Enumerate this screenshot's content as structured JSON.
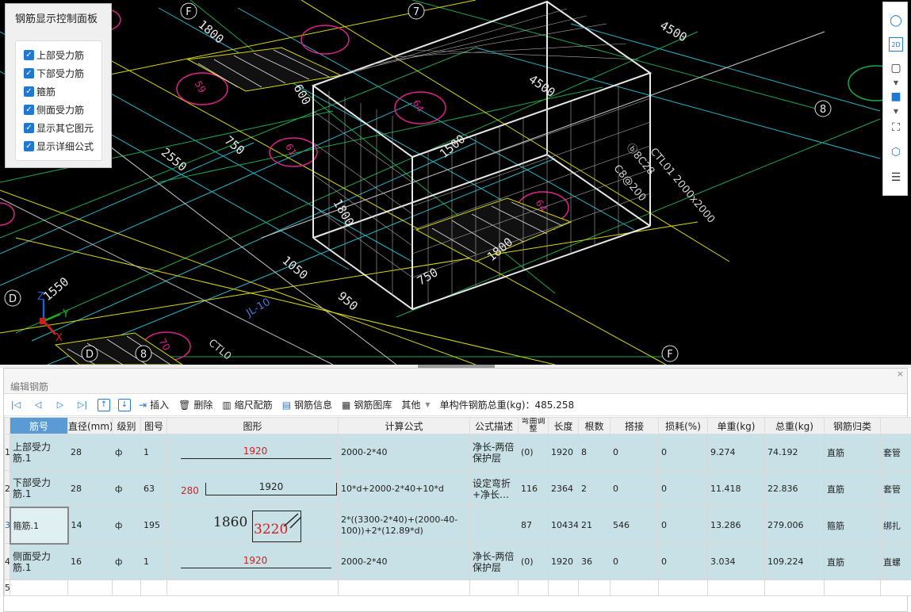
{
  "viewport": {
    "grid_labels": [
      "F",
      "7",
      "8",
      "D",
      "D",
      "8",
      "F"
    ],
    "dimensions": [
      "1800",
      "4500",
      "4500",
      "2550",
      "750",
      "1500",
      "1800",
      "1550",
      "1050",
      "950",
      "750",
      "1800",
      "750",
      "600"
    ],
    "circle_labels": [
      "59",
      "61",
      "64",
      "64",
      "70"
    ],
    "annotations": [
      "CTL01 2000x2000",
      "C8@200",
      "ⓑ8C28",
      "CTL0",
      "JL-10"
    ],
    "axes": {
      "z": "Z",
      "y": "Y",
      "x": "X"
    }
  },
  "control_panel": {
    "title": "钢筋显示控制面板",
    "options": [
      {
        "label": "上部受力筋",
        "checked": true
      },
      {
        "label": "下部受力筋",
        "checked": true
      },
      {
        "label": "箍筋",
        "checked": true
      },
      {
        "label": "侧面受力筋",
        "checked": true
      },
      {
        "label": "显示其它图元",
        "checked": true
      },
      {
        "label": "显示详细公式",
        "checked": true
      }
    ]
  },
  "right_toolbar": {
    "view2d": "2D"
  },
  "editor": {
    "title": "编辑钢筋",
    "close": "×",
    "toolbar": {
      "insert": "插入",
      "delete": "删除",
      "scale": "缩尺配筋",
      "info": "钢筋信息",
      "library": "钢筋图库",
      "other": "其他",
      "total_label": "单构件钢筋总重(kg)：485.258"
    },
    "columns": [
      "筋号",
      "直径(mm)",
      "级别",
      "图号",
      "图形",
      "计算公式",
      "公式描述",
      "弯曲调整",
      "长度",
      "根数",
      "搭接",
      "损耗(%)",
      "单重(kg)",
      "总重(kg)",
      "钢筋归类",
      ""
    ],
    "rows": [
      {
        "rn": "1",
        "name": "上部受力筋.1",
        "dia": "28",
        "grade": "ф",
        "fig": "1",
        "shape_main": "1920",
        "shape_left": "",
        "formula": "2000-2*40",
        "desc": "净长-两倍保护层",
        "bend": "(0)",
        "len": "1920",
        "count": "8",
        "lap": "0",
        "loss": "0",
        "unit": "9.274",
        "total": "74.192",
        "cat": "直筋",
        "extra": "套管"
      },
      {
        "rn": "2",
        "name": "下部受力筋.1",
        "dia": "28",
        "grade": "ф",
        "fig": "63",
        "shape_main": "1920",
        "shape_left": "280",
        "formula": "10*d+2000-2*40+10*d",
        "desc": "设定弯折+净长…",
        "bend": "116",
        "len": "2364",
        "count": "2",
        "lap": "0",
        "loss": "0",
        "unit": "11.418",
        "total": "22.836",
        "cat": "直筋",
        "extra": "套管"
      },
      {
        "rn": "3",
        "name": "箍筋.1",
        "dia": "14",
        "grade": "ф",
        "fig": "195",
        "shape_main": "3220",
        "shape_left": "1860",
        "formula": "2*((3300-2*40)+(2000-40-100))+2*(12.89*d)",
        "desc": "",
        "bend": "87",
        "len": "10434",
        "count": "21",
        "lap": "546",
        "loss": "0",
        "unit": "13.286",
        "total": "279.006",
        "cat": "箍筋",
        "extra": "绑扎"
      },
      {
        "rn": "4",
        "name": "侧面受力筋.1",
        "dia": "16",
        "grade": "ф",
        "fig": "1",
        "shape_main": "1920",
        "shape_left": "",
        "formula": "2000-2*40",
        "desc": "净长-两倍保护层",
        "bend": "(0)",
        "len": "1920",
        "count": "36",
        "lap": "0",
        "loss": "0",
        "unit": "3.034",
        "total": "109.224",
        "cat": "直筋",
        "extra": "直螺"
      },
      {
        "rn": "5"
      }
    ]
  }
}
